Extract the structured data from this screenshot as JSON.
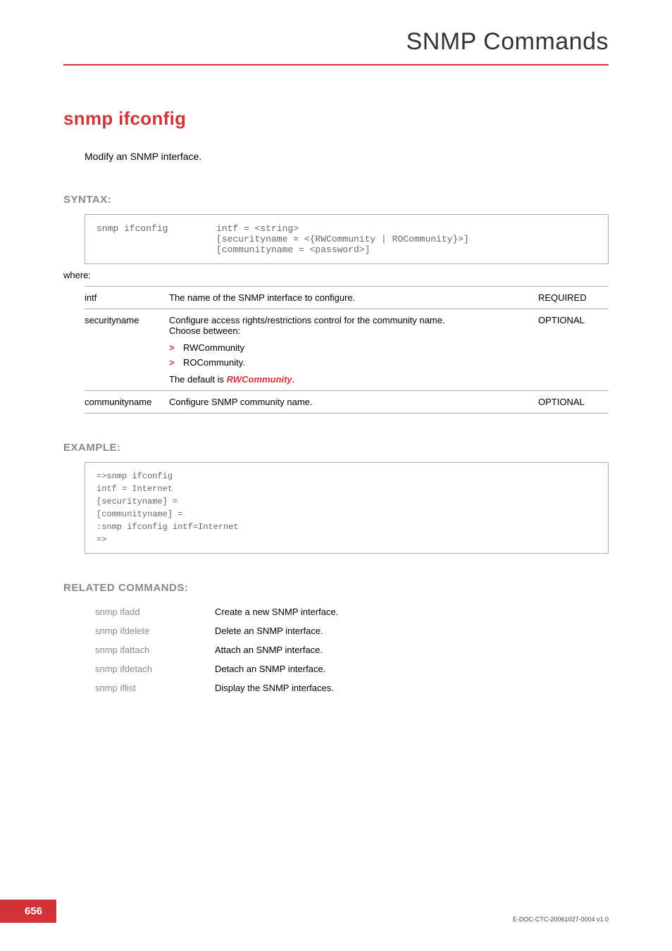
{
  "header": {
    "title": "SNMP Commands"
  },
  "command": {
    "name": "snmp ifconfig",
    "description": "Modify an SNMP interface."
  },
  "syntax": {
    "label": "SYNTAX:",
    "cmd": "snmp ifconfig",
    "args": "intf = <string>\n[securityname = <{RWCommunity | ROCommunity}>]\n[communityname = <password>]",
    "where": "where:"
  },
  "params": [
    {
      "name": "intf",
      "desc": "The name of the  SNMP interface to configure.",
      "req": "REQUIRED"
    },
    {
      "name": "securityname",
      "desc": "Configure access rights/restrictions control for the community name.\nChoose between:",
      "options": [
        "RWCommunity",
        "ROCommunity."
      ],
      "default_prefix": "The default is ",
      "default_value": "RWCommunity",
      "default_suffix": ".",
      "req": "OPTIONAL"
    },
    {
      "name": "communityname",
      "desc": "Configure SNMP community name.",
      "req": "OPTIONAL"
    }
  ],
  "example": {
    "label": "EXAMPLE:",
    "body": "=>snmp ifconfig\nintf = Internet\n[securityname] =\n[communityname] =\n:snmp ifconfig intf=Internet\n=>"
  },
  "related": {
    "label": "RELATED COMMANDS:",
    "rows": [
      {
        "cmd": "snmp ifadd",
        "desc": "Create a new SNMP interface."
      },
      {
        "cmd": "snmp ifdelete",
        "desc": "Delete an SNMP interface."
      },
      {
        "cmd": "snmp ifattach",
        "desc": "Attach an SNMP interface."
      },
      {
        "cmd": "snmp ifdetach",
        "desc": "Detach an SNMP interface."
      },
      {
        "cmd": "snmp iflist",
        "desc": "Display the SNMP interfaces."
      }
    ]
  },
  "footer": {
    "page": "656",
    "docid": "E-DOC-CTC-20061027-0004 v1.0"
  }
}
